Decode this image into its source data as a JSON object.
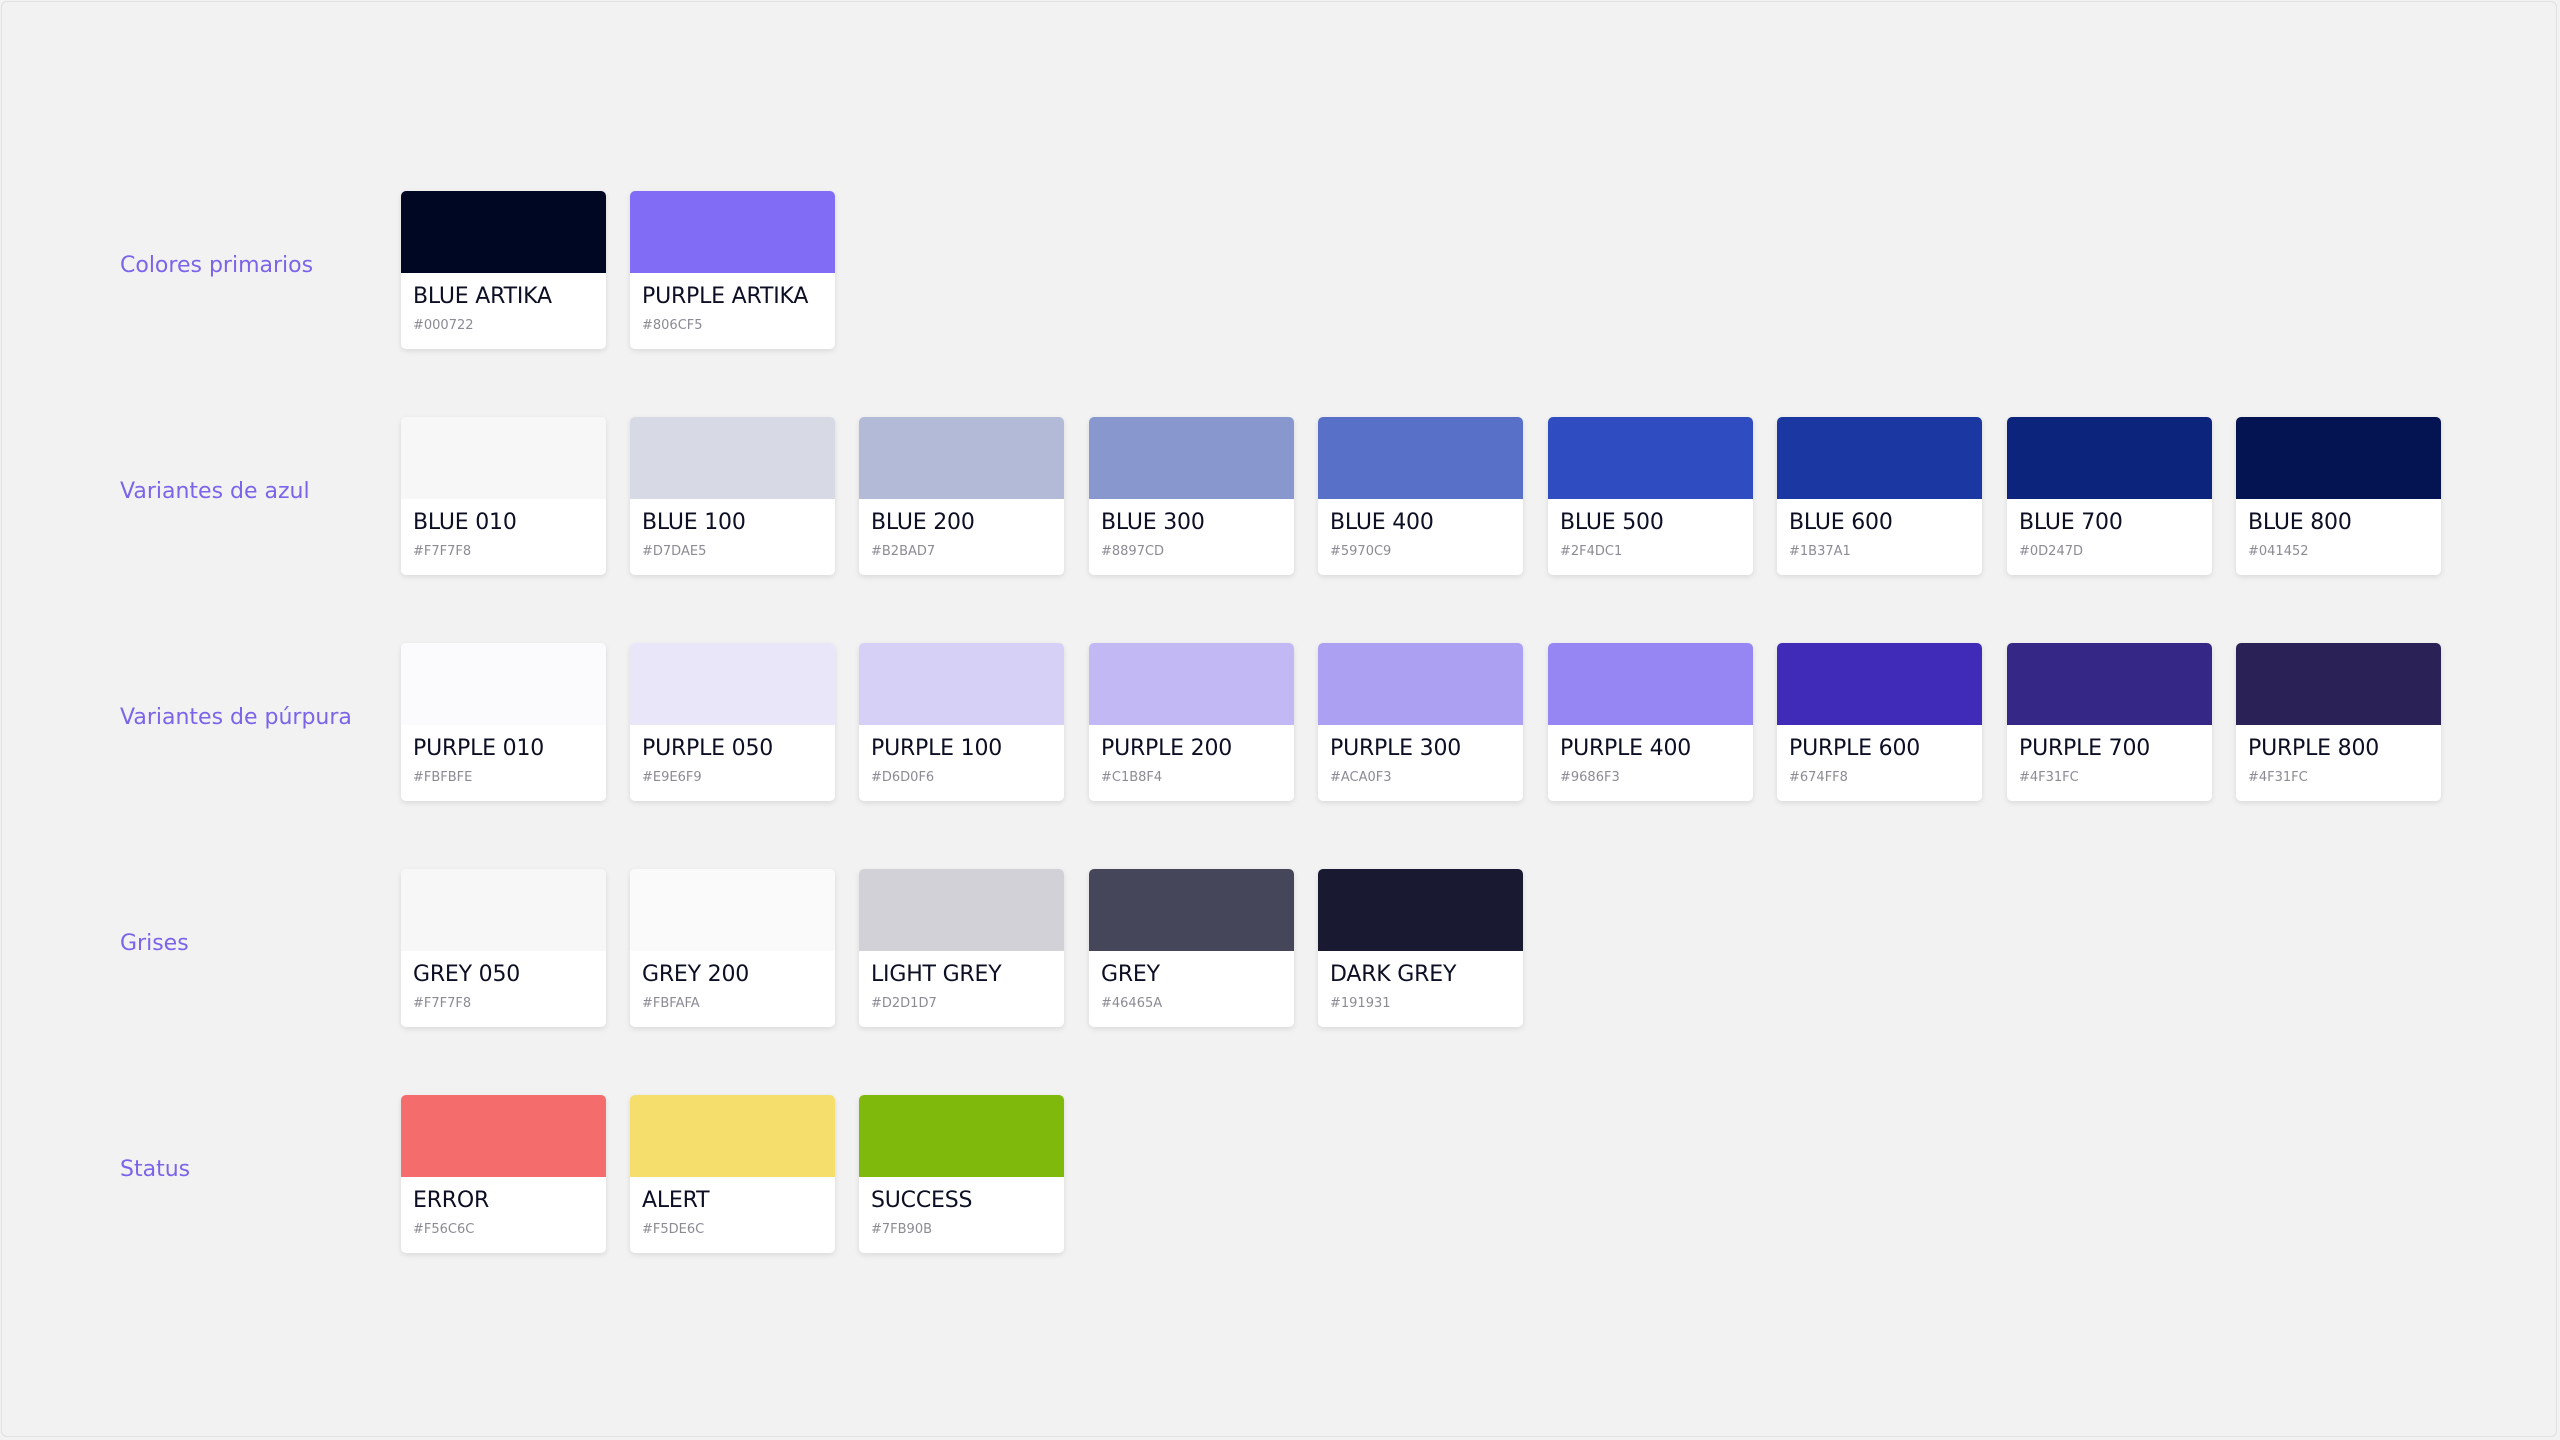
{
  "groups": [
    {
      "label": "Colores primarios",
      "colors": [
        {
          "name": "BLUE ARTIKA",
          "hex_label": "#000722",
          "color": "#000722"
        },
        {
          "name": "PURPLE ARTIKA",
          "hex_label": "#806CF5",
          "color": "#806CF5"
        }
      ]
    },
    {
      "label": "Variantes de azul",
      "colors": [
        {
          "name": "BLUE 010",
          "hex_label": "#F7F7F8",
          "color": "#F7F7F8"
        },
        {
          "name": "BLUE 100",
          "hex_label": "#D7DAE5",
          "color": "#D7DAE5"
        },
        {
          "name": "BLUE 200",
          "hex_label": "#B2BAD7",
          "color": "#B2BAD7"
        },
        {
          "name": "BLUE 300",
          "hex_label": "#8897CD",
          "color": "#8897CD"
        },
        {
          "name": "BLUE 400",
          "hex_label": "#5970C9",
          "color": "#5970C9"
        },
        {
          "name": "BLUE 500",
          "hex_label": "#2F4DC1",
          "color": "#2F4DC1"
        },
        {
          "name": "BLUE 600",
          "hex_label": "#1B37A1",
          "color": "#1B37A1"
        },
        {
          "name": "BLUE 700",
          "hex_label": "#0D247D",
          "color": "#0D247D"
        },
        {
          "name": "BLUE 800",
          "hex_label": "#041452",
          "color": "#041452"
        }
      ]
    },
    {
      "label": "Variantes de púrpura",
      "colors": [
        {
          "name": "PURPLE 010",
          "hex_label": "#FBFBFE",
          "color": "#FBFBFE"
        },
        {
          "name": "PURPLE 050",
          "hex_label": "#E9E6F9",
          "color": "#E9E6F9"
        },
        {
          "name": "PURPLE 100",
          "hex_label": "#D6D0F6",
          "color": "#D6D0F6"
        },
        {
          "name": "PURPLE 200",
          "hex_label": "#C1B8F4",
          "color": "#C1B8F4"
        },
        {
          "name": "PURPLE 300",
          "hex_label": "#ACA0F3",
          "color": "#ACA0F3"
        },
        {
          "name": "PURPLE 400",
          "hex_label": "#9686F3",
          "color": "#9686F3"
        },
        {
          "name": "PURPLE 600",
          "hex_label": "#674FF8",
          "color": "#3F2BB8"
        },
        {
          "name": "PURPLE 700",
          "hex_label": "#4F31FC",
          "color": "#352785"
        },
        {
          "name": "PURPLE 800",
          "hex_label": "#4F31FC",
          "color": "#2A2256"
        }
      ]
    },
    {
      "label": "Grises",
      "colors": [
        {
          "name": "GREY 050",
          "hex_label": "#F7F7F8",
          "color": "#F7F7F8"
        },
        {
          "name": "GREY 200",
          "hex_label": "#FBFAFA",
          "color": "#FBFAFA"
        },
        {
          "name": "LIGHT GREY",
          "hex_label": "#D2D1D7",
          "color": "#D2D1D7"
        },
        {
          "name": "GREY",
          "hex_label": "#46465A",
          "color": "#46465A"
        },
        {
          "name": "DARK GREY",
          "hex_label": "#191931",
          "color": "#191931"
        }
      ]
    },
    {
      "label": "Status",
      "colors": [
        {
          "name": "ERROR",
          "hex_label": "#F56C6C",
          "color": "#F56C6C"
        },
        {
          "name": "ALERT",
          "hex_label": "#F5DE6C",
          "color": "#F5DE6C"
        },
        {
          "name": "SUCCESS",
          "hex_label": "#7FB90B",
          "color": "#7FB90B"
        }
      ]
    }
  ]
}
